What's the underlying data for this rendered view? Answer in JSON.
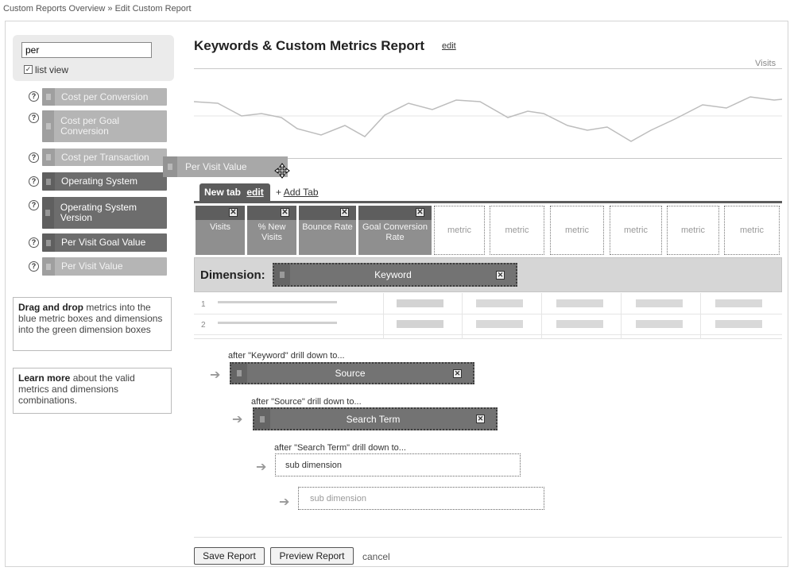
{
  "breadcrumb": "Custom Reports Overview » Edit Custom Report",
  "sidebar": {
    "search_value": "per",
    "list_view_label": "list view",
    "list_view_checked": "✓",
    "help_glyph": "?",
    "items": [
      {
        "label": "Cost per Conversion"
      },
      {
        "label": "Cost per Goal Conversion"
      },
      {
        "label": "Cost per Transaction"
      },
      {
        "label": "Operating System"
      },
      {
        "label": "Operating System Version"
      },
      {
        "label": "Per Visit Goal Value"
      },
      {
        "label": "Per Visit Value"
      }
    ],
    "help_dragdrop_bold": "Drag and drop",
    "help_dragdrop_text": " metrics into the blue metric boxes and dimensions into the green dimension boxes",
    "help_learn_bold": "Learn more",
    "help_learn_text": " about the valid metrics and dimensions combinations."
  },
  "report": {
    "title": "Keywords & Custom Metrics Report",
    "edit_label": "edit",
    "chart_series_label": "Visits"
  },
  "tabs": {
    "active_label": "New tab",
    "active_edit": "edit",
    "add_prefix": "+ ",
    "add_label": "Add Tab"
  },
  "metrics": {
    "remove_glyph": "✕",
    "columns": [
      "Visits",
      "% New Visits",
      "Bounce Rate",
      "Goal Conversion Rate"
    ],
    "empty_slots": [
      "metric",
      "metric",
      "metric",
      "metric",
      "metric",
      "metric"
    ]
  },
  "dimension": {
    "label": "Dimension:",
    "value": "Keyword",
    "remove_glyph": "✕"
  },
  "table": {
    "row_numbers": [
      "1",
      "2"
    ]
  },
  "drilldown": [
    {
      "caption": "after \"Keyword\" drill down to...",
      "value": "Source"
    },
    {
      "caption": "after \"Source\" drill down to...",
      "value": "Search Term"
    },
    {
      "caption": "after \"Search Term\" drill down to...",
      "placeholder": "sub dimension"
    },
    {
      "placeholder": "sub dimension"
    }
  ],
  "drag_ghost_label": "Per Visit Value",
  "icons": {
    "help": "help-icon",
    "remove": "close-icon",
    "drag": "grip-icon",
    "arrow": "arrow-right-icon",
    "cursor": "move-cursor-icon"
  },
  "buttons": {
    "save": "Save Report",
    "preview": "Preview Report",
    "cancel": "cancel"
  },
  "colors": {
    "metric_dark": "#5e5e5e",
    "metric_col": "#8f8f8f",
    "dimension_bar": "#d6d6d6"
  }
}
